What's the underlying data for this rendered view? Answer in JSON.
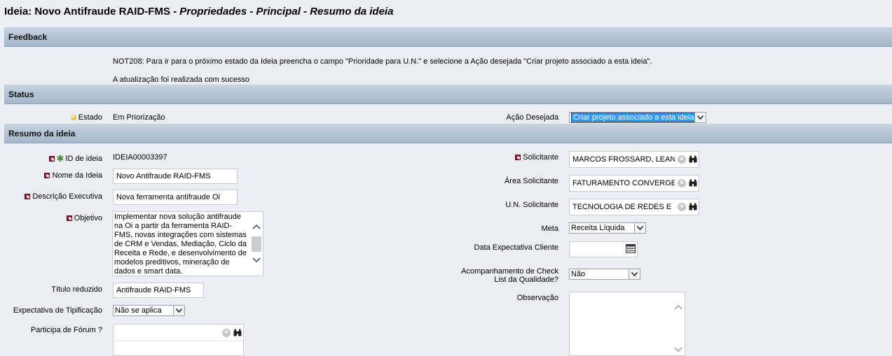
{
  "page_title": {
    "prefix": "Ideia: Novo Antifraude RAID-FMS",
    "sep1": " - ",
    "part1": "Propriedades",
    "sep2": " - ",
    "part2": "Principal",
    "sep3": " - ",
    "part3": "Resumo da ideia"
  },
  "sections": {
    "feedback": "Feedback",
    "status": "Status",
    "resumo": "Resumo da ideia"
  },
  "feedback": {
    "message1": "NOT208: Para ir para o próximo estado da Ideia preencha o campo \"Prioridade para U.N.\" e selecione a Ação desejada \"Criar projeto associado a esta ideia\".",
    "message2": "A atualização foi realizada com sucesso"
  },
  "status": {
    "estado_label": "Estado",
    "estado_value": "Em Priorização",
    "acao_label": "Ação Desejada",
    "acao_value": "Criar projeto associado a esta ideia"
  },
  "left": {
    "id_label": "ID de ideia",
    "id_value": "IDEIA00003397",
    "nome_label": "Nome da Ideia",
    "nome_value": "Novo Antifraude RAID-FMS",
    "desc_label": "Descrição Executiva",
    "desc_value": "Nova ferramenta antifraude Oi",
    "objetivo_label": "Objetivo",
    "objetivo_lines": [
      "Implementar nova solução antifraude",
      "na Oi a partir da ferramenta RAID-",
      "FMS, novas integrações com sistemas",
      "de CRM e Vendas, Mediação, Ciclo da",
      "Receita e Rede, e desenvolvimento de",
      "modelos preditivos, mineração de",
      "dados e smart data."
    ],
    "titulo_label": "Título reduzido",
    "titulo_value": "Antifraude RAID-FMS",
    "tipificacao_label": "Expectativa de Tipificação",
    "tipificacao_value": "Não se aplica",
    "forum_label": "Participa de Fórum ?",
    "forum_value": ""
  },
  "right": {
    "solicitante_label": "Solicitante",
    "solicitante_value": "MARCOS FROSSARD, LEAN",
    "area_label": "Área Solicitante",
    "area_value": "FATURAMENTO CONVERGE",
    "un_label": "U.N. Solicitante",
    "un_value": "TECNOLOGIA DE REDES E",
    "meta_label": "Meta",
    "meta_value": "Receita Líquida",
    "data_label": "Data Expectativa Cliente",
    "data_value": "",
    "check_label_1": "Acompanhamento de Check",
    "check_label_2": "List da Qualidade?",
    "check_value": "Não",
    "obs_label": "Observação",
    "obs_value": ""
  },
  "icons": {
    "required": "required-marker-icon",
    "status_bullet": "status-bullet-icon",
    "clear": "clear-icon",
    "lookup": "binoculars-icon",
    "calendar": "calendar-icon",
    "dropdown": "chevron-down-icon"
  },
  "colors": {
    "background": "#ecedf5",
    "section_bar": "#b6c5d6",
    "required_marker": "#8b1a2a",
    "selection_highlight": "#3399ff"
  }
}
